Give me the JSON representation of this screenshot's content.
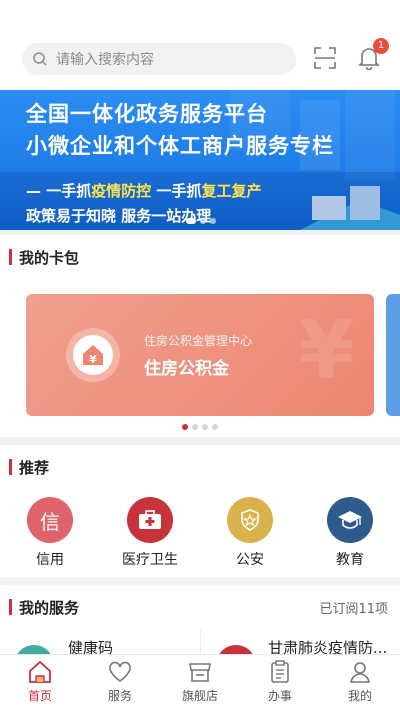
{
  "header": {
    "search_placeholder": "请输入搜索内容",
    "notification_count": "1"
  },
  "banner": {
    "line1": "全国一体化政务服务平台",
    "line2": "小微企业和个体工商户服务专栏",
    "slogan_a1": "一手抓",
    "slogan_a2": "疫情防控",
    "slogan_a3": " 一手抓",
    "slogan_a4": "复工复产",
    "slogan_b": "政策易于知晓 服务一站办理"
  },
  "wallet": {
    "title": "我的卡包",
    "card": {
      "subtitle": "住房公积金管理中心",
      "name": "住房公积金",
      "deco": "¥"
    }
  },
  "recommend": {
    "title": "推荐",
    "items": [
      {
        "label": "信用",
        "glyph": "信",
        "color": "#e0626a"
      },
      {
        "label": "医疗卫生",
        "color": "#c8323b"
      },
      {
        "label": "公安",
        "color": "#d9b24c"
      },
      {
        "label": "教育",
        "color": "#2f5a8c"
      }
    ]
  },
  "services": {
    "title": "我的服务",
    "subscribed": "已订阅11项",
    "items": [
      {
        "name": "健康码",
        "color": "#3fae9c"
      },
      {
        "name": "甘肃肺炎疫情防...",
        "color": "#c8323b"
      }
    ]
  },
  "tabbar": {
    "items": [
      {
        "label": "首页",
        "active": true
      },
      {
        "label": "服务"
      },
      {
        "label": "旗舰店"
      },
      {
        "label": "办事"
      },
      {
        "label": "我的"
      }
    ]
  },
  "colors": {
    "accent": "#c8323b",
    "banner_blue": "#1f7ee8"
  }
}
